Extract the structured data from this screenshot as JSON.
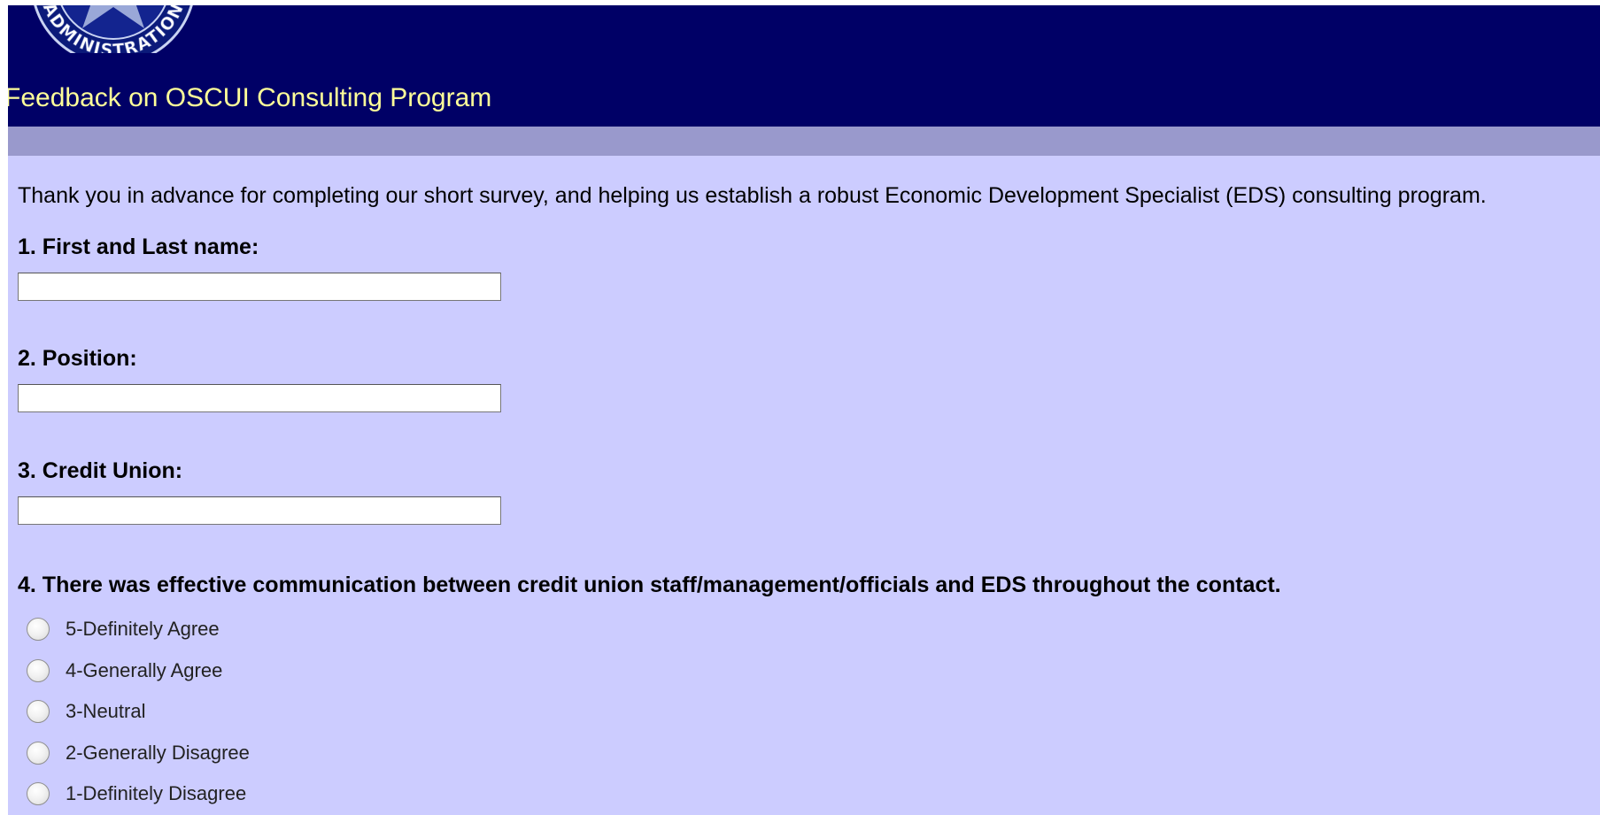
{
  "header": {
    "title": "Feedback on OSCUI Consulting Program",
    "seal_text": "ADMINISTRATION",
    "colors": {
      "header_bg": "#000066",
      "title_text": "#ffff99",
      "subbar_bg": "#9999cc",
      "page_bg": "#ccccff"
    }
  },
  "survey": {
    "intro": "Thank you in advance for completing our short survey, and helping us establish a robust Economic Development Specialist (EDS) consulting program.",
    "questions": [
      {
        "label": "1. First and Last name:",
        "value": ""
      },
      {
        "label": "2. Position:",
        "value": ""
      },
      {
        "label": "3. Credit Union:",
        "value": ""
      },
      {
        "label": "4. There was effective communication between credit union staff/management/officials and EDS throughout the contact.",
        "options": [
          "5-Definitely Agree",
          "4-Generally Agree",
          "3-Neutral",
          "2-Generally Disagree",
          "1-Definitely Disagree"
        ],
        "selected": null
      }
    ]
  }
}
